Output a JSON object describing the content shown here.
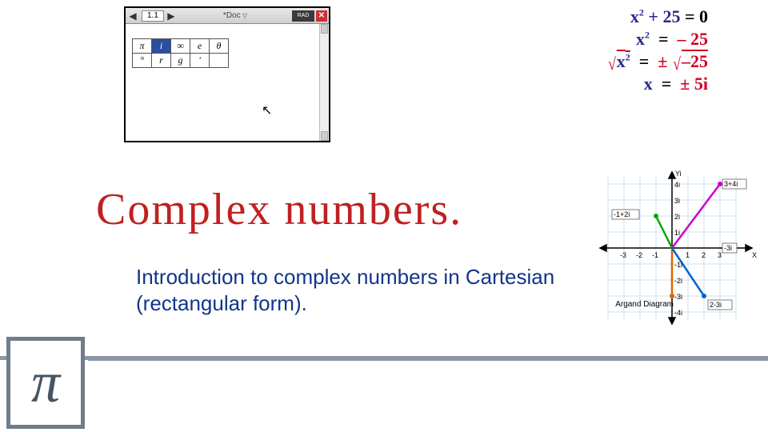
{
  "calc": {
    "back_arrow": "◀",
    "fwd_arrow": "▶",
    "tab_label": "1.1",
    "doc_label": "*Doc",
    "rad_label": "RAD",
    "close_label": "✕",
    "symbols_row1": [
      "π",
      "i",
      "∞",
      "e",
      "θ"
    ],
    "symbols_row2": [
      "°",
      "r",
      "g",
      "'",
      ""
    ],
    "selected_symbol_index": 1,
    "cursor_glyph": "↖"
  },
  "math": {
    "line1_lhs": "x",
    "line1_lhs_exp": "2",
    "line1_plus": "+ 25",
    "eq": "=",
    "line1_rhs": "0",
    "line2_lhs": "x",
    "line2_lhs_exp": "2",
    "line2_rhs": "– 25",
    "line3_lhs_sqrt": "√",
    "line3_lhs_rad": "x",
    "line3_lhs_exp": "2",
    "line3_rhs_pm": "±",
    "line3_rhs_sqrt": "√",
    "line3_rhs_rad": "–25",
    "line4_lhs": "x",
    "line4_rhs_pm": "±",
    "line4_rhs": "5i"
  },
  "title": "Complex numbers.",
  "subtitle": "Introduction to complex numbers in    Cartesian (rectangular form).",
  "argand": {
    "y_label": "Yi",
    "x_label": "X",
    "caption": "Argand Diagram",
    "x_ticks": [
      "-3",
      "-2",
      "-1",
      "1",
      "2",
      "3"
    ],
    "y_ticks": [
      "-4i",
      "-3i",
      "-2i",
      "-1i",
      "1i",
      "2i",
      "3i",
      "4i"
    ],
    "points": [
      {
        "label": "-1+2i",
        "color": "#0a0"
      },
      {
        "label": "3+4i",
        "color": "#c0c"
      },
      {
        "label": "-3i",
        "color": "#d60"
      },
      {
        "label": "2-3i",
        "color": "#06c"
      }
    ]
  },
  "pi_glyph": "π",
  "chart_data": {
    "type": "scatter",
    "title": "Argand Diagram",
    "xlabel": "X",
    "ylabel": "Yi",
    "xlim": [
      -3.5,
      3.5
    ],
    "ylim": [
      -4.5,
      4.5
    ],
    "grid": true,
    "series": [
      {
        "name": "-1+2i",
        "x": [
          -1
        ],
        "y": [
          2
        ],
        "color": "#0a0"
      },
      {
        "name": "3+4i",
        "x": [
          3
        ],
        "y": [
          4
        ],
        "color": "#c0c"
      },
      {
        "name": "-3i",
        "x": [
          0
        ],
        "y": [
          -3
        ],
        "color": "#d60"
      },
      {
        "name": "2-3i",
        "x": [
          2
        ],
        "y": [
          -3
        ],
        "color": "#06c"
      }
    ],
    "x_ticks": [
      -3,
      -2,
      -1,
      1,
      2,
      3
    ],
    "y_ticks": [
      -4,
      -3,
      -2,
      -1,
      1,
      2,
      3,
      4
    ]
  }
}
